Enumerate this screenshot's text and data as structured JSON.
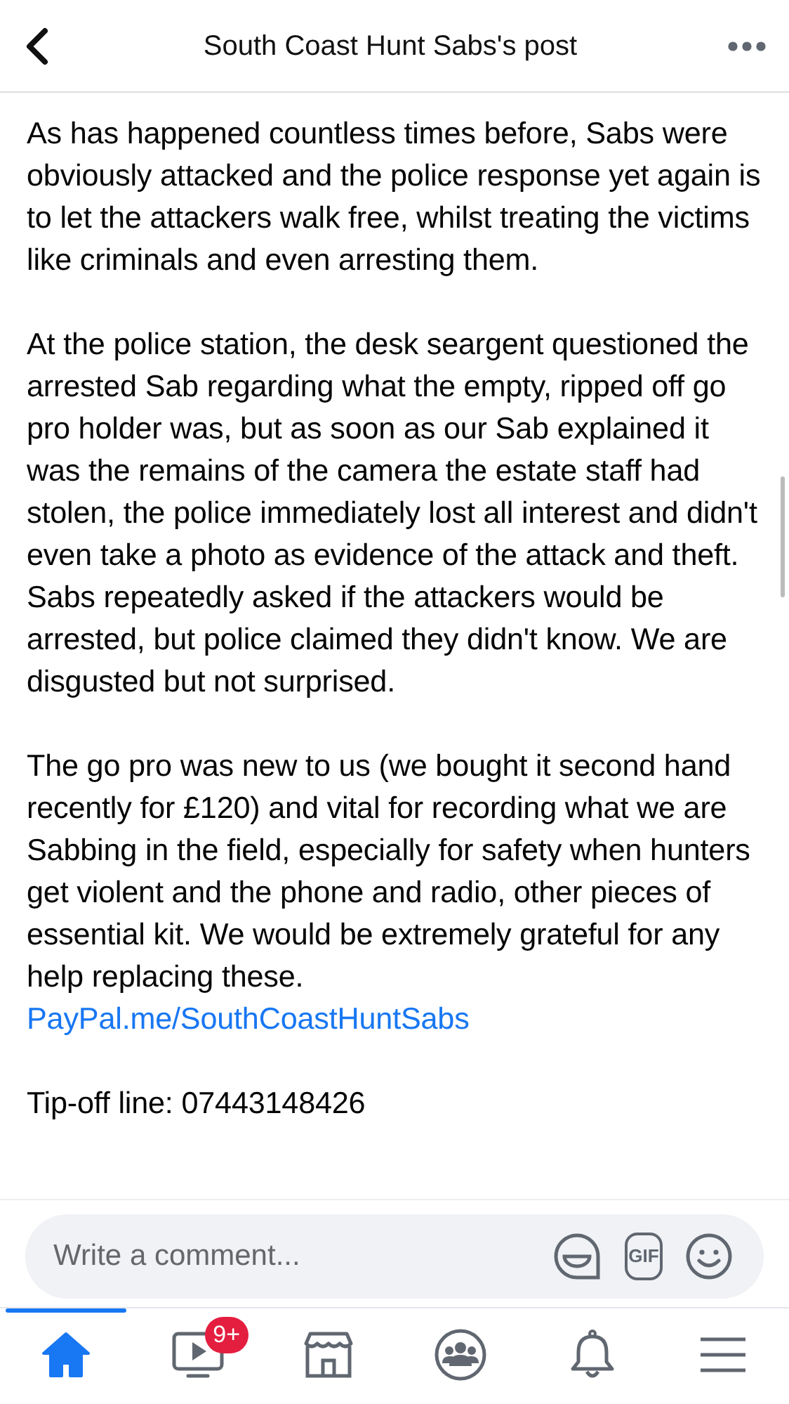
{
  "header": {
    "title": "South Coast Hunt Sabs's post"
  },
  "post": {
    "paragraphs": [
      {
        "text": "As has happened countless times before, Sabs were obviously attacked and the police response yet again is to let the attackers walk free, whilst treating the victims like criminals and even arresting them."
      },
      {
        "text": "At the police station, the desk seargent questioned the arrested Sab regarding what the empty, ripped off go pro holder was, but as soon as our Sab explained it was the remains of the camera the estate staff had stolen, the police immediately lost all interest and didn't even take a photo as evidence of the attack and theft. Sabs repeatedly asked if the attackers would be arrested, but police claimed they didn't know. We are disgusted but not surprised."
      },
      {
        "text": "The go pro was new to us (we bought it second hand recently for £120) and vital for recording what we are Sabbing in the field, especially for safety when hunters get violent and the phone and radio, other pieces of essential kit. We would be extremely grateful for any help replacing these.",
        "link": "PayPal.me/SouthCoastHuntSabs"
      },
      {
        "text": "Tip-off line: 07443148426"
      }
    ]
  },
  "comment_bar": {
    "placeholder": "Write a comment...",
    "gif_label": "GIF"
  },
  "tabs": [
    {
      "kind": "home",
      "selected": true
    },
    {
      "kind": "video",
      "selected": false,
      "badge": "9+"
    },
    {
      "kind": "marketplace",
      "selected": false
    },
    {
      "kind": "groups",
      "selected": false
    },
    {
      "kind": "bell",
      "selected": false
    },
    {
      "kind": "menu",
      "selected": false
    }
  ]
}
